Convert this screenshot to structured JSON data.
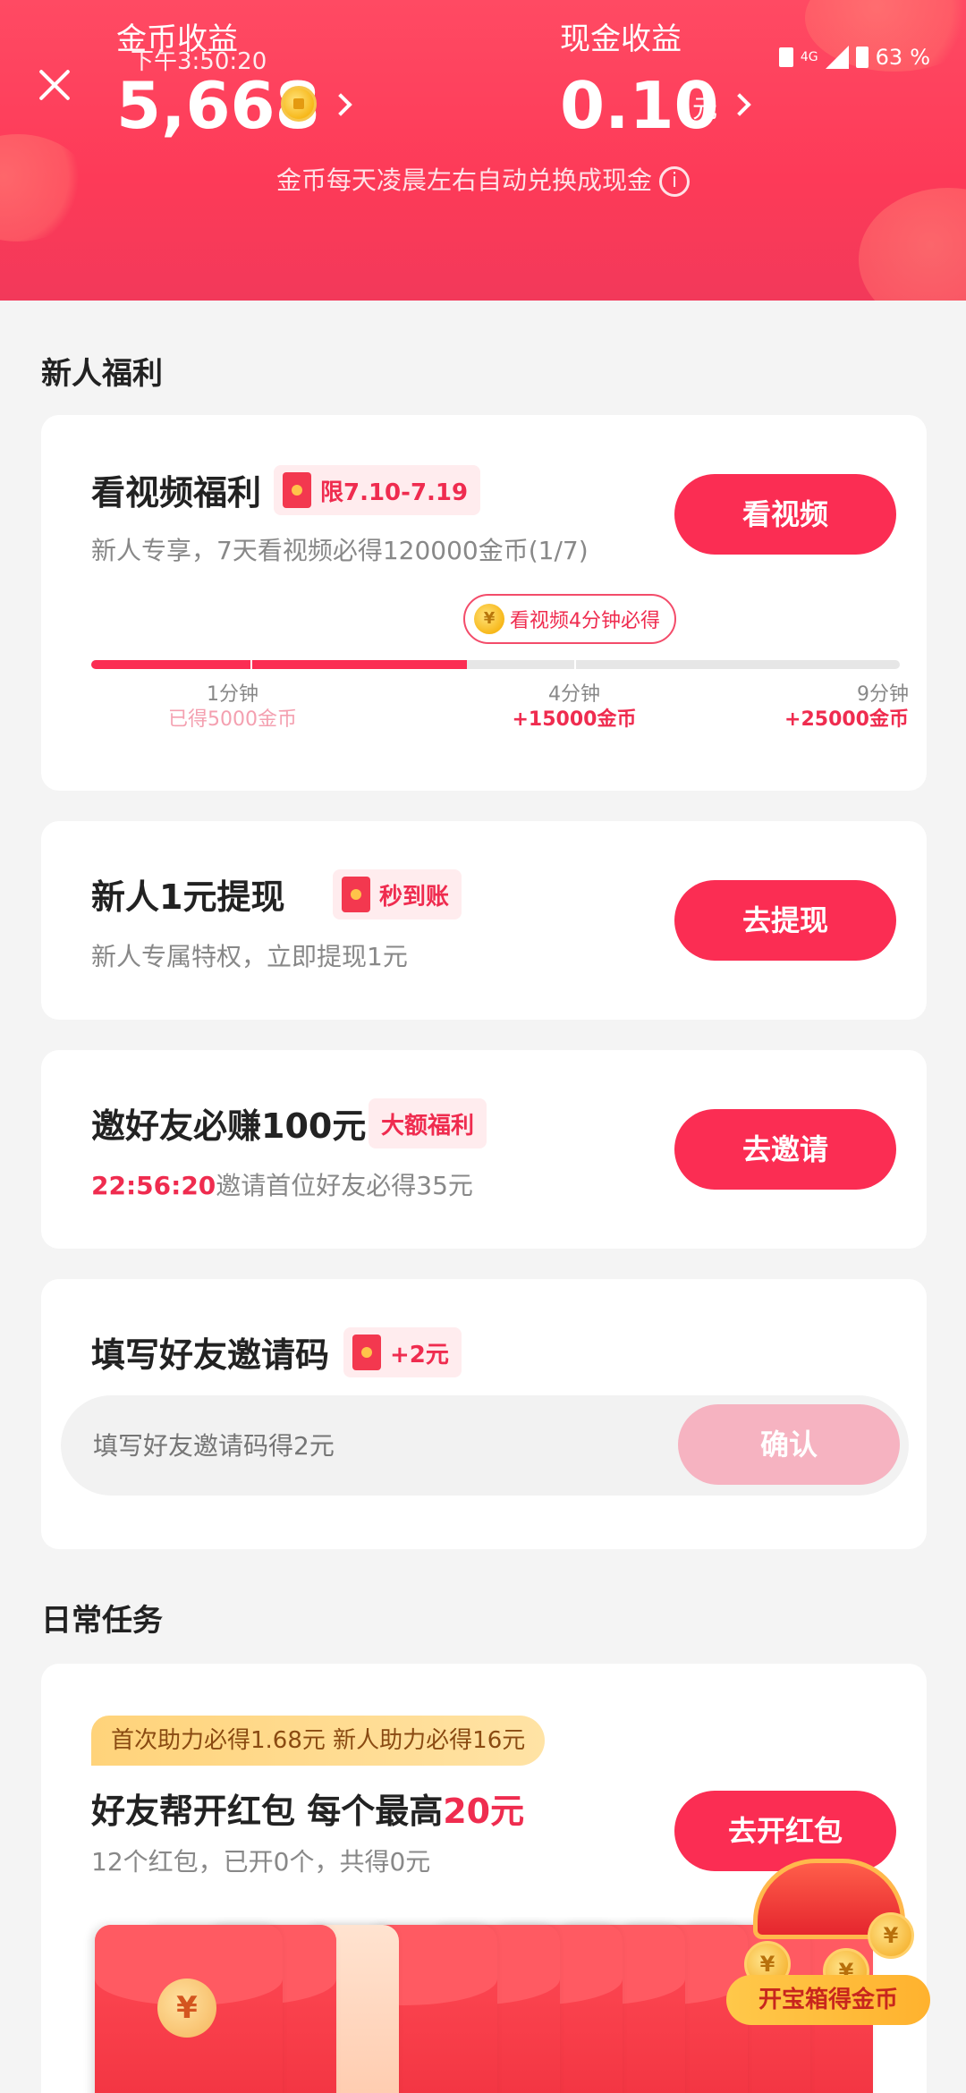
{
  "header": {
    "coin_label": "金币收益",
    "time": "下午3:50:20",
    "coin_value": "5,668",
    "cash_label": "现金收益",
    "cash_value": "0.10",
    "cash_unit": "元",
    "note": "金币每天凌晨左右自动兑换成现金",
    "status": {
      "network": "4G",
      "battery": "63",
      "battery_unit": "%"
    }
  },
  "newbie": {
    "section_title": "新人福利",
    "video": {
      "title": "看视频福利",
      "tag": "限7.10-7.19",
      "sub": "新人专享，7天看视频必得120000金币(1/7)",
      "button": "看视频",
      "bubble": "看视频4分钟必得",
      "bubble_coin": "¥",
      "progress": 0.465,
      "milestones": [
        {
          "time": "1分钟",
          "reward": "已得5000金币",
          "done": true
        },
        {
          "time": "4分钟",
          "reward": "+15000金币",
          "done": false
        },
        {
          "time": "9分钟",
          "reward": "+25000金币",
          "done": false
        }
      ]
    },
    "withdraw": {
      "title": "新人1元提现",
      "tag": "秒到账",
      "sub": "新人专属特权，立即提现1元",
      "button": "去提现"
    },
    "invite": {
      "title": "邀好友必赚100元",
      "tag": "大额福利",
      "countdown": "22:56:20",
      "sub": "邀请首位好友必得35元",
      "button": "去邀请"
    },
    "code": {
      "title": "填写好友邀请码",
      "tag": "+2元",
      "placeholder": "填写好友邀请码得2元",
      "button": "确认"
    }
  },
  "daily": {
    "section_title": "日常任务",
    "redpacket": {
      "tip": "首次助力必得1.68元 新人助力必得16元",
      "title_prefix": "好友帮开红包 每个最高",
      "title_amount": "20元",
      "sub": "12个红包，已开0个，共得0元",
      "button": "去开红包",
      "envelope_symbol": "¥",
      "chest_label": "开宝箱得金币"
    }
  }
}
